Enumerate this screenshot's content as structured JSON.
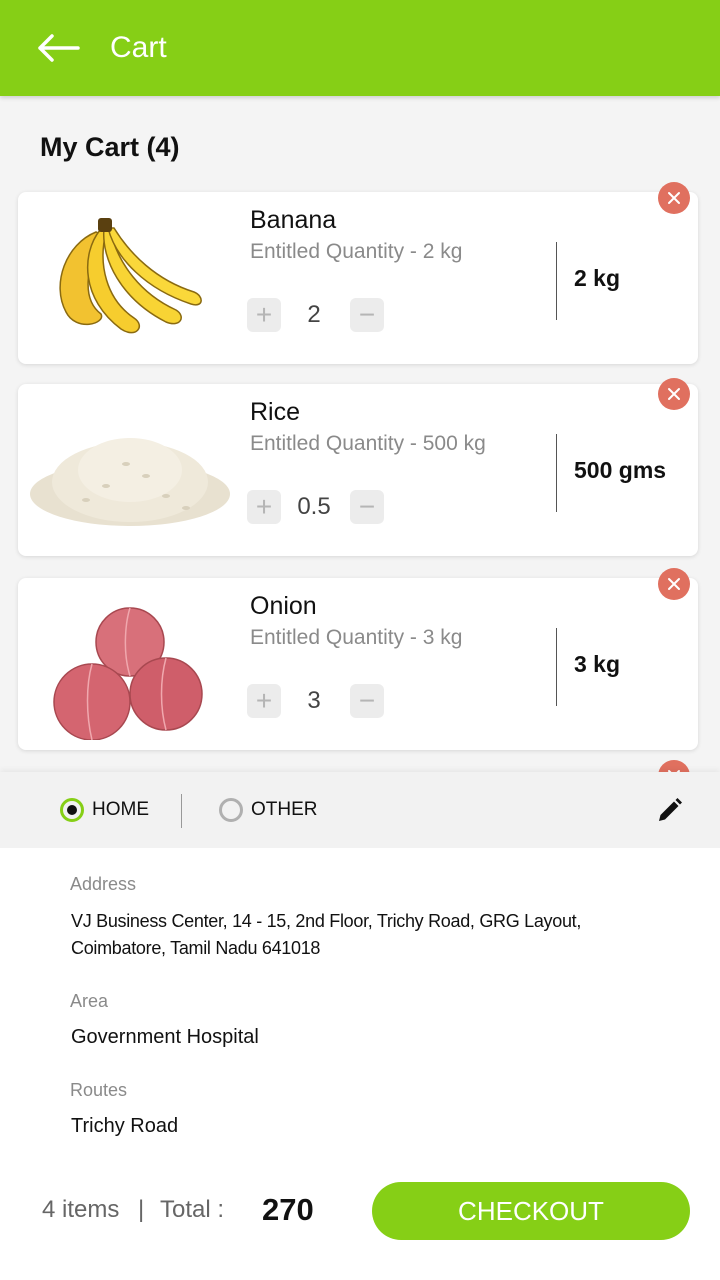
{
  "appbar": {
    "title": "Cart",
    "back_icon": "arrow-left-icon"
  },
  "cart": {
    "heading": "My Cart (4)",
    "items": [
      {
        "name": "Banana",
        "entitled": "Entitled Quantity - 2 kg",
        "qty": "2",
        "weight": "2 kg",
        "plus": "+",
        "minus": "−"
      },
      {
        "name": "Rice",
        "entitled": "Entitled Quantity - 500 kg",
        "qty": "0.5",
        "weight": "500 gms",
        "plus": "+",
        "minus": "−"
      },
      {
        "name": "Onion",
        "entitled": "Entitled Quantity -  3 kg",
        "qty": "3",
        "weight": "3 kg",
        "plus": "+",
        "minus": "−"
      }
    ]
  },
  "address_type": {
    "home": {
      "label": "HOME",
      "selected": true
    },
    "other": {
      "label": "OTHER",
      "selected": false
    }
  },
  "address": {
    "address_label": "Address",
    "address_line1": "VJ Business Center, 14 - 15, 2nd Floor, Trichy Road, GRG Layout,",
    "address_line2": "Coimbatore, Tamil Nadu 641018",
    "area_label": "Area",
    "area_value": "Government Hospital",
    "routes_label": "Routes",
    "routes_value": "Trichy Road"
  },
  "footer": {
    "items": "4 items",
    "separator": "|",
    "total_label": "Total :",
    "total_value": "270",
    "checkout_label": "CHECKOUT"
  },
  "colors": {
    "accent": "#86cf16",
    "remove": "#e0705f"
  }
}
